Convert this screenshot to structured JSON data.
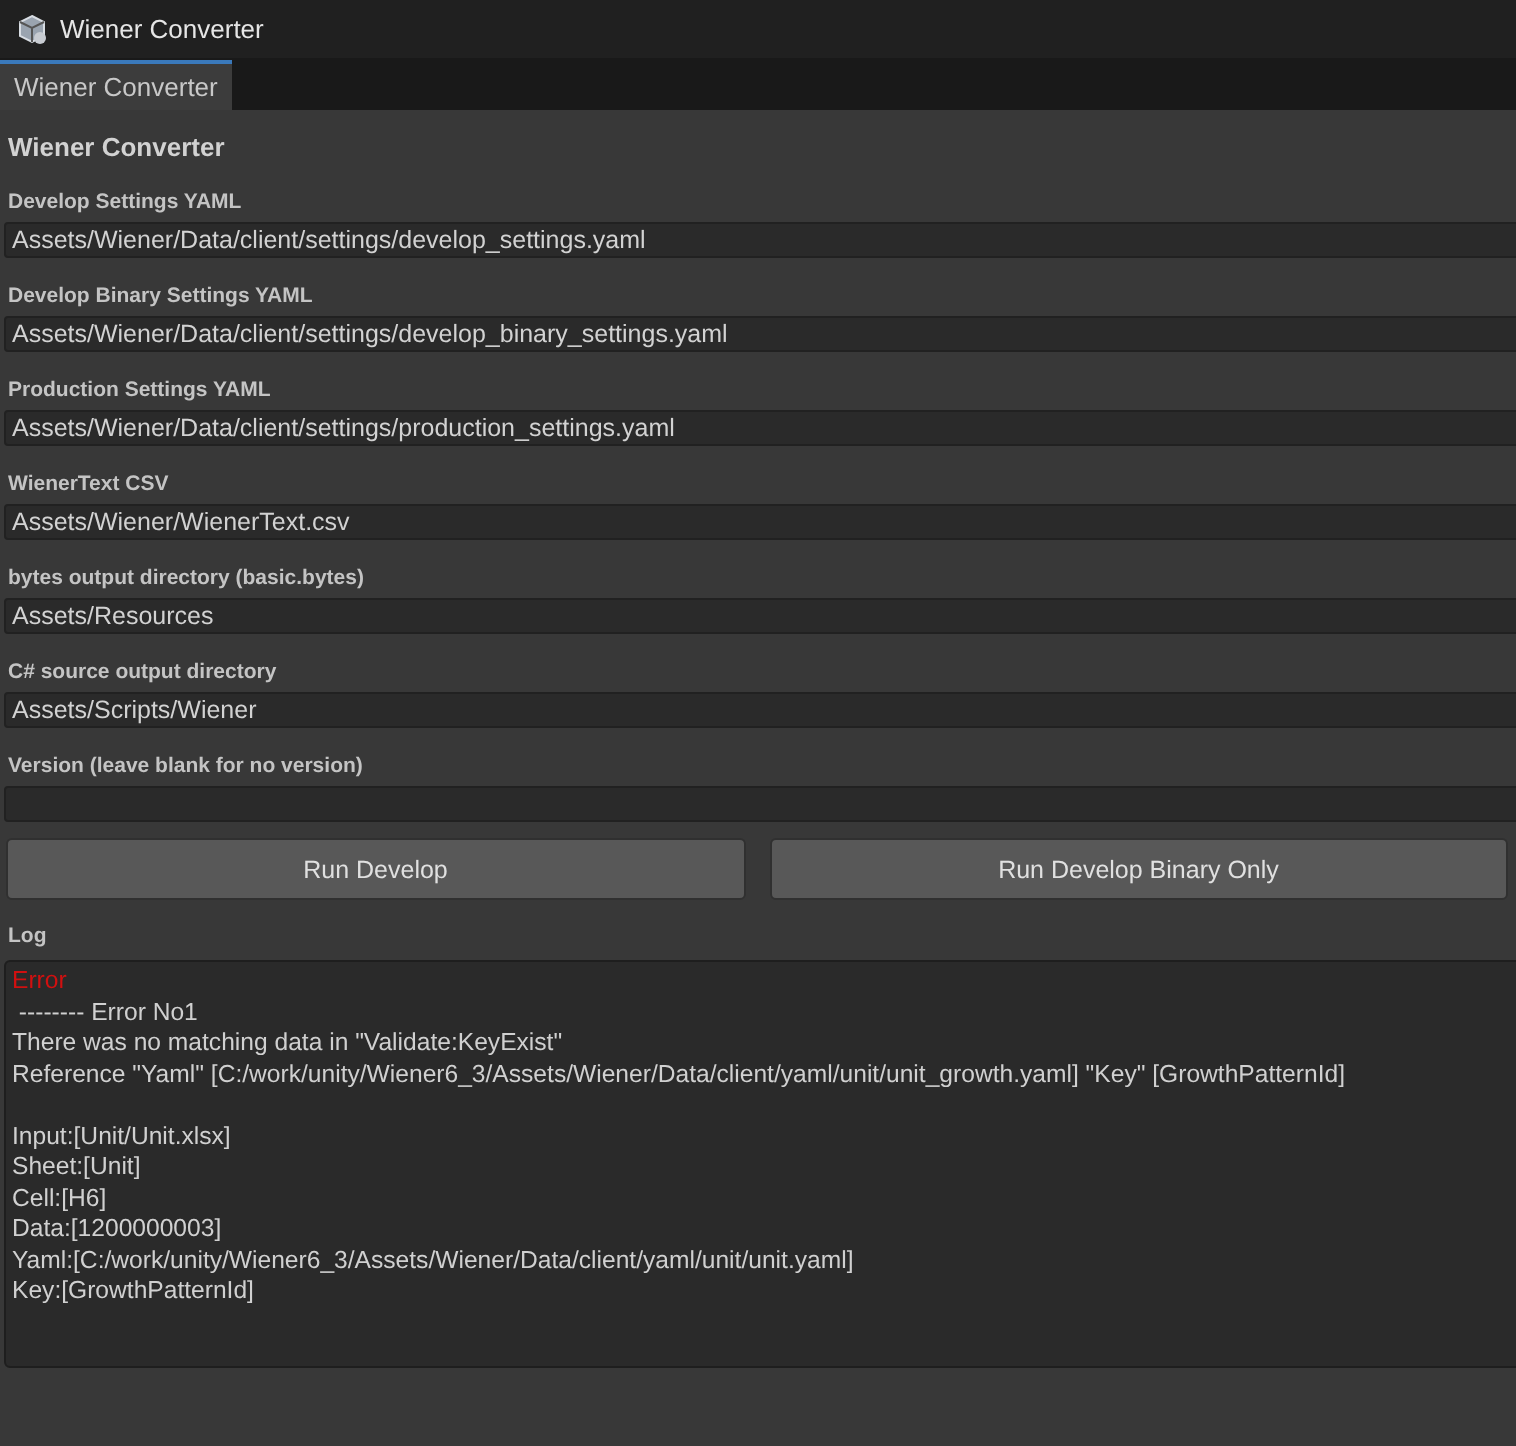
{
  "window": {
    "title": "Wiener Converter"
  },
  "tabs": [
    {
      "label": "Wiener Converter",
      "selected": true
    }
  ],
  "heading": "Wiener Converter",
  "fields": [
    {
      "label": "Develop Settings YAML",
      "value": "Assets/Wiener/Data/client/settings/develop_settings.yaml"
    },
    {
      "label": "Develop Binary Settings YAML",
      "value": "Assets/Wiener/Data/client/settings/develop_binary_settings.yaml"
    },
    {
      "label": "Production Settings YAML",
      "value": "Assets/Wiener/Data/client/settings/production_settings.yaml"
    },
    {
      "label": "WienerText CSV",
      "value": "Assets/Wiener/WienerText.csv"
    },
    {
      "label": "bytes output directory (basic.bytes)",
      "value": "Assets/Resources"
    },
    {
      "label": "C# source output directory",
      "value": "Assets/Scripts/Wiener"
    },
    {
      "label": "Version (leave blank for no version)"
    }
  ],
  "buttons": [
    "Run Develop",
    "Run Develop Binary Only"
  ],
  "log": {
    "label": "Log",
    "lines": [
      {
        "text": "Error",
        "kind": "error"
      },
      {
        "text": " -------- Error No1",
        "kind": "plain"
      },
      {
        "text": "There was no matching data in \"Validate:KeyExist\"",
        "kind": "plain"
      },
      {
        "text": "Reference \"Yaml\" [C:/work/unity/Wiener6_3/Assets/Wiener/Data/client/yaml/unit/unit_growth.yaml] \"Key\" [GrowthPatternId]",
        "kind": "plain"
      },
      {
        "text": "Input:[Unit/Unit.xlsx]",
        "kind": "plain_gap"
      },
      {
        "text": "Sheet:[Unit]",
        "kind": "plain"
      },
      {
        "text": "Cell:[H6]",
        "kind": "plain"
      },
      {
        "text": "Data:[1200000003]",
        "kind": "plain"
      },
      {
        "text": "Yaml:[C:/work/unity/Wiener6_3/Assets/Wiener/Data/client/yaml/unit/unit.yaml]",
        "kind": "plain"
      },
      {
        "text": "Key:[GrowthPatternId]",
        "kind": "plain"
      }
    ]
  }
}
